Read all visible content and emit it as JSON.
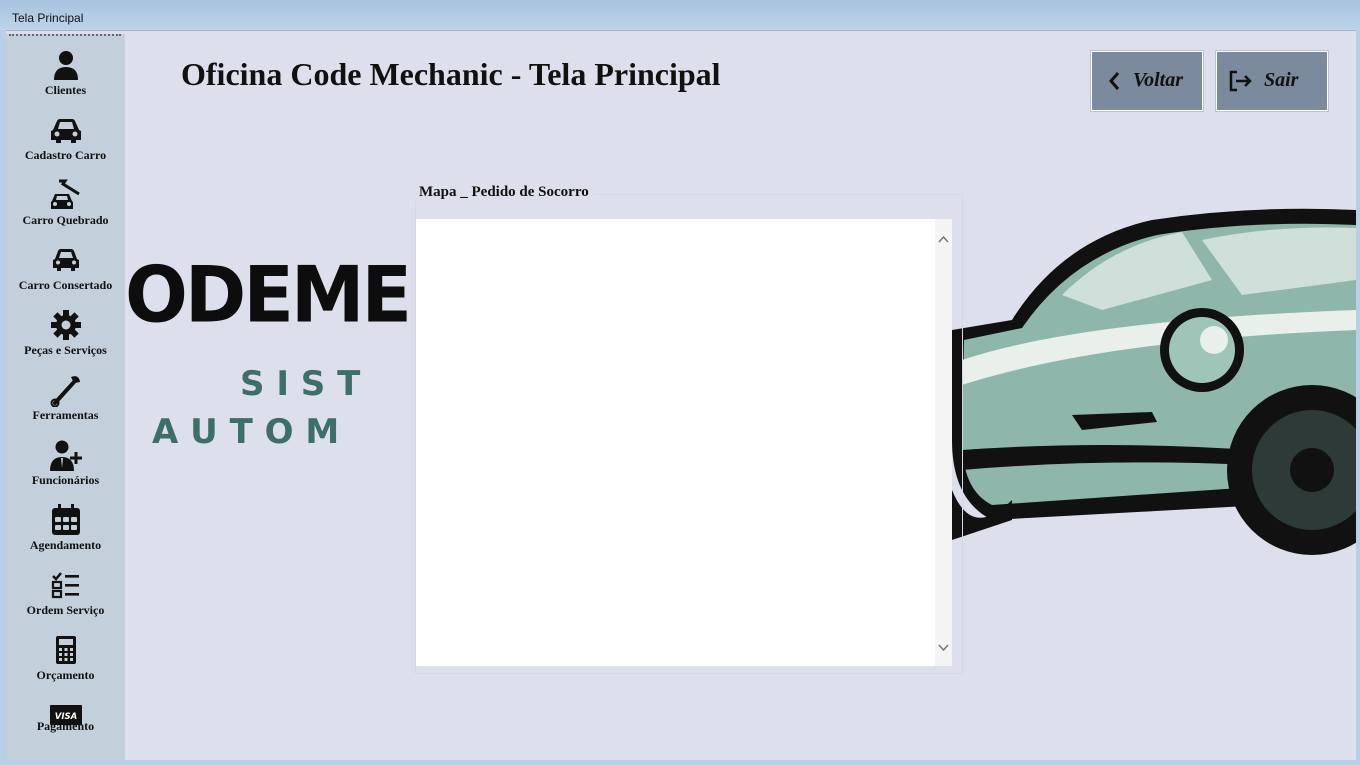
{
  "window": {
    "title": "Tela Principal"
  },
  "header": {
    "title": "Oficina Code Mechanic - Tela Principal"
  },
  "buttons": {
    "back_label": "Voltar",
    "exit_label": "Sair"
  },
  "sidebar": {
    "items": [
      {
        "label": "Clientes",
        "icon": "person-icon"
      },
      {
        "label": "Cadastro Carro",
        "icon": "car-icon"
      },
      {
        "label": "Carro Quebrado",
        "icon": "car-wrench-icon"
      },
      {
        "label": "Carro Consertado",
        "icon": "car-icon"
      },
      {
        "label": "Peças e Serviços",
        "icon": "gear-icon"
      },
      {
        "label": "Ferramentas",
        "icon": "wrench-icon"
      },
      {
        "label": "Funcionários",
        "icon": "employee-add-icon"
      },
      {
        "label": "Agendamento",
        "icon": "calendar-icon"
      },
      {
        "label": "Ordem  Serviço",
        "icon": "checklist-icon"
      },
      {
        "label": "Orçamento",
        "icon": "calculator-icon"
      },
      {
        "label": "Pagamento",
        "icon": "visa-card-icon"
      }
    ]
  },
  "background": {
    "logo_text": "ODEME",
    "logo_sub1": "S I S T",
    "logo_sub2": "A U T O M"
  },
  "map_panel": {
    "title": "Mapa _ Pedido de Socorro"
  },
  "colors": {
    "background": "#dde0ec",
    "sidebar": "#c3cfdb",
    "button": "#7b8a9c",
    "logo_accent": "#3d6e68"
  }
}
